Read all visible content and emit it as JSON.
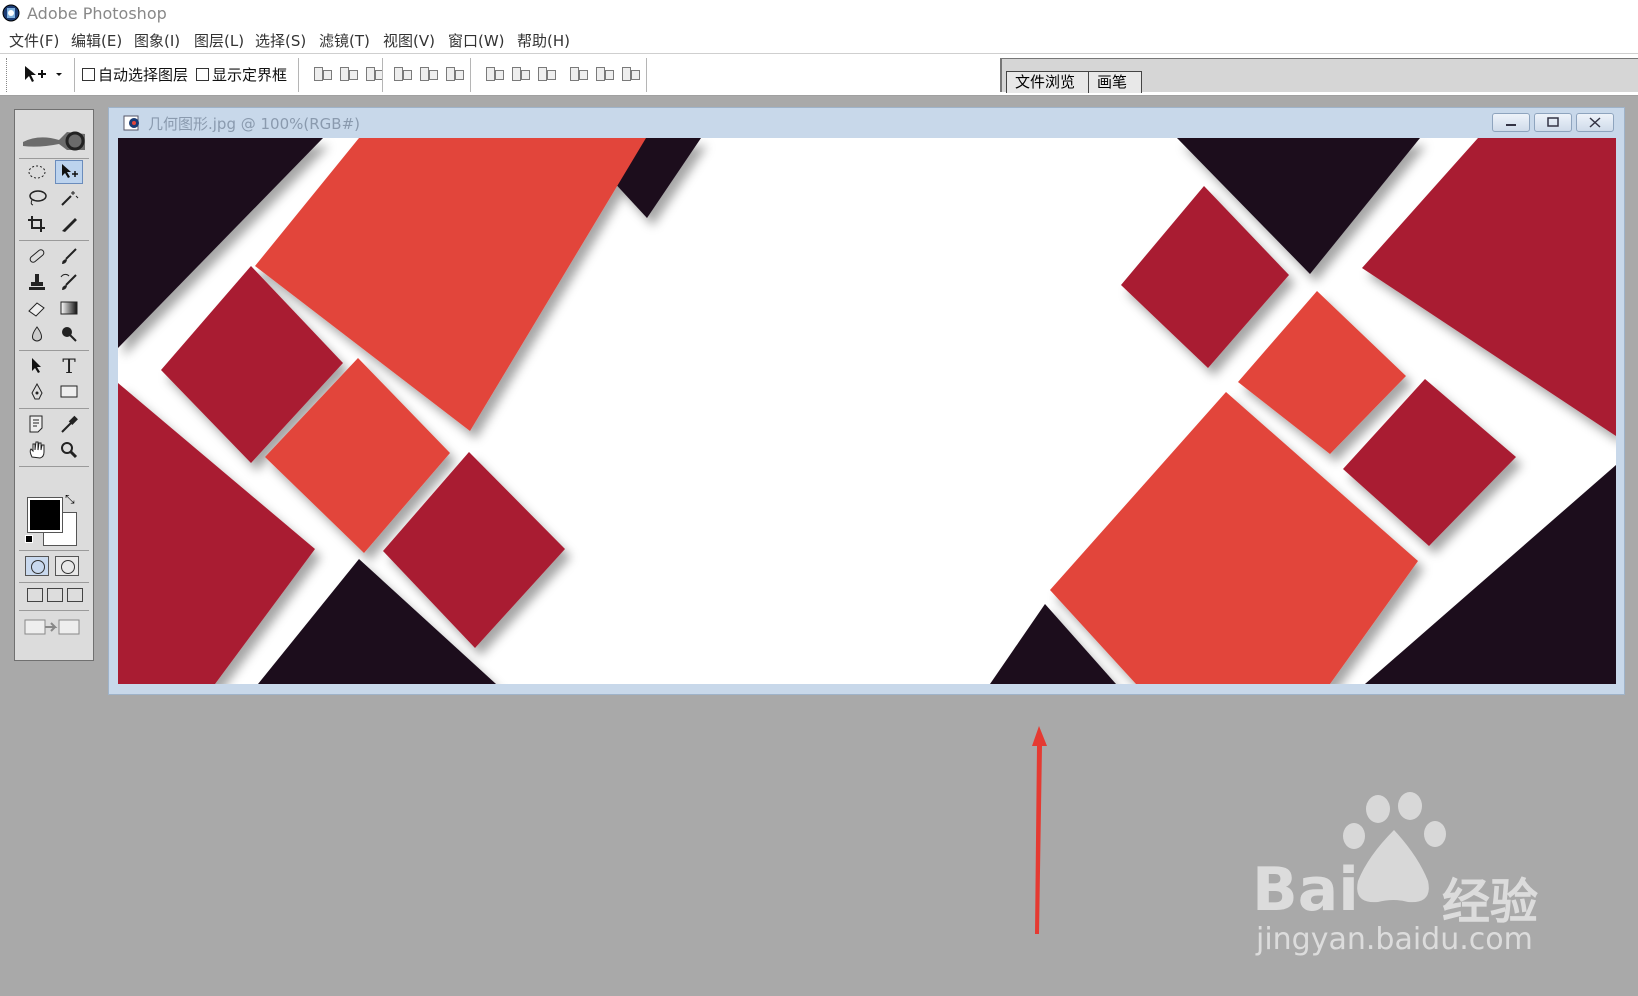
{
  "app": {
    "title": "Adobe Photoshop",
    "icon": "photoshop-app-icon"
  },
  "menu": [
    "文件(F)",
    "编辑(E)",
    "图象(I)",
    "图层(L)",
    "选择(S)",
    "滤镜(T)",
    "视图(V)",
    "窗口(W)",
    "帮助(H)"
  ],
  "options": {
    "auto_select_label": "自动选择图层",
    "auto_select_checked": false,
    "show_bounds_label": "显示定界框",
    "show_bounds_checked": false
  },
  "palette_well": {
    "tabs": [
      "文件浏览",
      "画笔"
    ]
  },
  "toolbox": {
    "tools": [
      "marquee",
      "move",
      "lasso",
      "magic-wand",
      "crop",
      "slice",
      "healing-brush",
      "brush",
      "clone-stamp",
      "history-brush",
      "eraser",
      "gradient",
      "blur",
      "dodge",
      "path-selection",
      "type",
      "pen",
      "shape",
      "notes",
      "eyedropper",
      "hand",
      "zoom"
    ],
    "type_tool_glyph": "T",
    "active_tool": "move",
    "foreground_color": "#000000",
    "background_color": "#ffffff"
  },
  "document": {
    "title": "几何图形.jpg @ 100%(RGB#)",
    "colors": {
      "red": "#e2453b",
      "crimson": "#a91d31",
      "dark": "#1c0d1c"
    }
  },
  "watermark": {
    "brand_a": "Bai",
    "brand_b": "经验",
    "url": "jingyan.baidu.com"
  },
  "annotation": {
    "arrow_color": "#e53a32"
  }
}
